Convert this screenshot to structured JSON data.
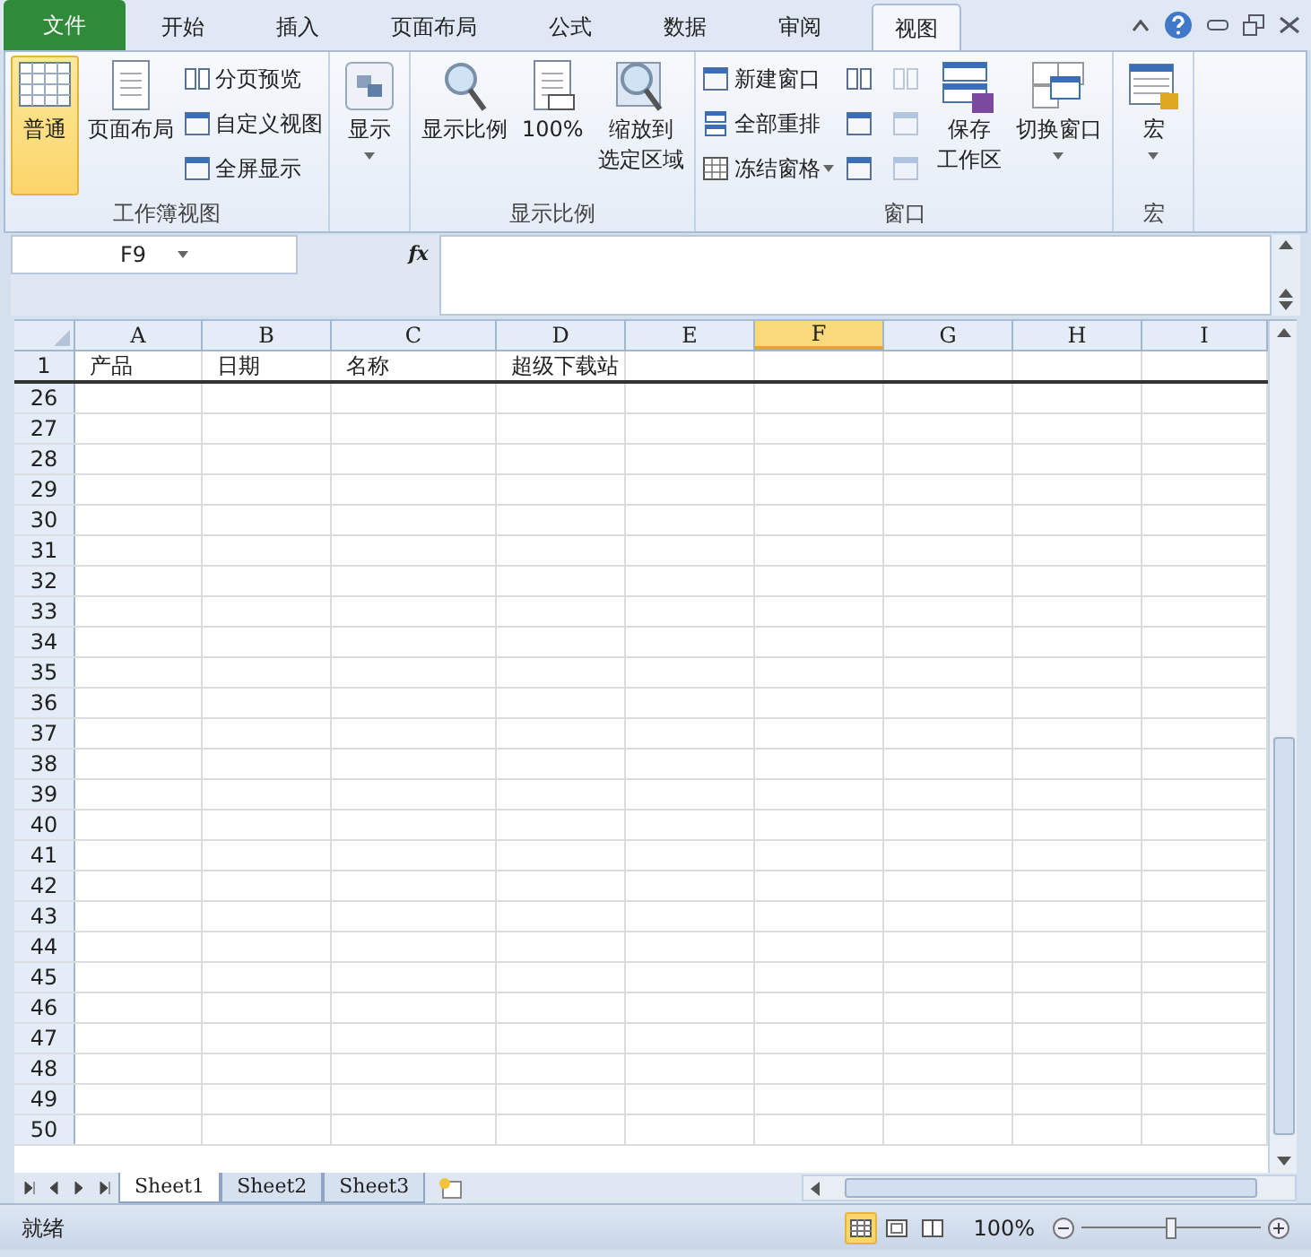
{
  "tabs": [
    {
      "label": "文件",
      "kind": "file",
      "selected": false
    },
    {
      "label": "开始",
      "kind": "tab",
      "selected": false
    },
    {
      "label": "插入",
      "kind": "tab",
      "selected": false
    },
    {
      "label": "页面布局",
      "kind": "tab",
      "selected": false
    },
    {
      "label": "公式",
      "kind": "tab",
      "selected": false
    },
    {
      "label": "数据",
      "kind": "tab",
      "selected": false
    },
    {
      "label": "审阅",
      "kind": "tab",
      "selected": false
    },
    {
      "label": "视图",
      "kind": "tab",
      "selected": true
    }
  ],
  "ribbon_groups": [
    {
      "label": "工作簿视图",
      "items": [
        {
          "kind": "large",
          "lines": [
            "普通"
          ],
          "selected": true
        },
        {
          "kind": "large",
          "lines": [
            "页面布局"
          ],
          "selected": false
        },
        {
          "kind": "stack",
          "buttons": [
            {
              "label": "分页预览"
            },
            {
              "label": "自定义视图"
            },
            {
              "label": "全屏显示"
            }
          ]
        }
      ]
    },
    {
      "items": [
        {
          "kind": "large",
          "lines": [
            "显示"
          ],
          "selected": false,
          "dropdown": true
        }
      ]
    },
    {
      "label": "显示比例",
      "items": [
        {
          "kind": "large",
          "lines": [
            "显示比例"
          ],
          "selected": false
        },
        {
          "kind": "large",
          "lines": [
            "100%"
          ],
          "selected": false
        },
        {
          "kind": "large",
          "lines": [
            "缩放到",
            "选定区域"
          ],
          "selected": false
        }
      ]
    },
    {
      "label": "窗口",
      "items": [
        {
          "kind": "stack",
          "buttons": [
            {
              "label": "新建窗口"
            },
            {
              "label": "全部重排"
            },
            {
              "label": "冻结窗格",
              "dropdown": true
            }
          ]
        },
        {
          "kind": "iconstack",
          "buttons": [
            {
              "disabled": false
            },
            {
              "disabled": false
            },
            {
              "disabled": false
            }
          ]
        },
        {
          "kind": "iconstack",
          "buttons": [
            {
              "disabled": true
            },
            {
              "disabled": true
            },
            {
              "disabled": true
            }
          ]
        },
        {
          "kind": "large",
          "lines": [
            "保存",
            "工作区"
          ],
          "selected": false
        },
        {
          "kind": "large",
          "lines": [
            "切换窗口"
          ],
          "selected": false,
          "dropdown": true
        }
      ]
    },
    {
      "label": "宏",
      "items": [
        {
          "kind": "large",
          "lines": [
            "宏"
          ],
          "selected": false,
          "dropdown": true
        }
      ]
    }
  ],
  "name_box": "F9",
  "function_button": "fx",
  "columns": [
    {
      "label": "A",
      "selected": false
    },
    {
      "label": "B",
      "selected": false
    },
    {
      "label": "C",
      "selected": false
    },
    {
      "label": "D",
      "selected": false
    },
    {
      "label": "E",
      "selected": false
    },
    {
      "label": "F",
      "selected": true
    },
    {
      "label": "G",
      "selected": false
    },
    {
      "label": "H",
      "selected": false
    },
    {
      "label": "I",
      "selected": false
    }
  ],
  "frozen_row": {
    "header": "1",
    "cells": [
      "产品",
      "日期",
      "名称",
      "超级下载站"
    ]
  },
  "row_headers": [
    "26",
    "27",
    "28",
    "29",
    "30",
    "31",
    "32",
    "33",
    "34",
    "35",
    "36",
    "37",
    "38",
    "39",
    "40",
    "41",
    "42",
    "43",
    "44",
    "45",
    "46",
    "47",
    "48",
    "49",
    "50"
  ],
  "sheet_tabs": [
    {
      "label": "Sheet1",
      "selected": true
    },
    {
      "label": "Sheet2",
      "selected": false
    },
    {
      "label": "Sheet3",
      "selected": false
    }
  ],
  "status": "就绪",
  "view_buttons": [
    {
      "kind": "normal",
      "selected": true
    },
    {
      "kind": "layout",
      "selected": false
    },
    {
      "kind": "pagebreak",
      "selected": false
    }
  ],
  "zoom": {
    "reading": "100%",
    "level": 0.5
  }
}
